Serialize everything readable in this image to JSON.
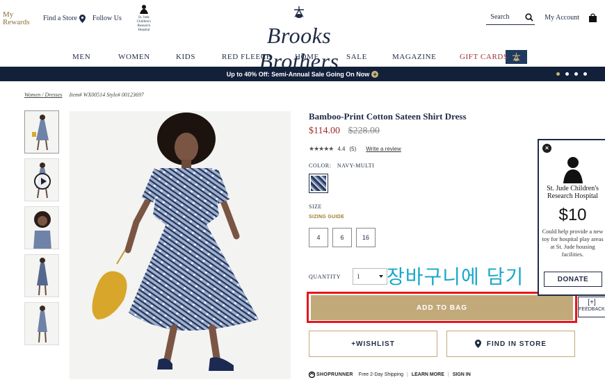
{
  "header": {
    "rewards_line1": "My",
    "rewards_line2": "Rewards",
    "find_store": "Find a Store",
    "follow_us": "Follow Us",
    "stjude_mini": "St. Jude Children's Research Hospital",
    "logo": "Brooks Brothers",
    "search_label": "Search",
    "my_account": "My Account"
  },
  "nav": {
    "items": [
      "MEN",
      "WOMEN",
      "KIDS",
      "RED FLEECE",
      "HOME",
      "SALE",
      "MAGAZINE",
      "GIFT CARDS"
    ]
  },
  "promo": {
    "text": "Up to 40% Off: Semi-Annual Sale Going On Now",
    "plus": "+"
  },
  "breadcrumb": {
    "path": "Women / Dresses",
    "item": "Item# WX00514 Style# 00123697"
  },
  "product": {
    "title": "Bamboo-Print Cotton Sateen Shirt Dress",
    "sale_price": "$114.00",
    "original_price": "$228.00",
    "stars": "★★★★★",
    "rating": "4.4",
    "review_count": "(5)",
    "write_review": "Write a review",
    "color_label": "COLOR:",
    "color_value": "NAVY-MULTI",
    "size_label": "SIZE",
    "sizing_guide": "SIZING GUIDE",
    "sizes": [
      "4",
      "6",
      "16"
    ],
    "quantity_label": "QUANTITY",
    "quantity_value": "1",
    "korean_caption": "장바구니에 담기",
    "add_to_bag": "ADD TO BAG",
    "wishlist": "+WISHLIST",
    "find_in_store": "FIND IN STORE"
  },
  "shoprunner": {
    "brand": "SHOPRUNNER",
    "shipping": "Free 2-Day Shipping",
    "learn_more": "LEARN MORE",
    "sign_in": "SIGN IN",
    "separator": "|"
  },
  "popup": {
    "close": "×",
    "org_line1": "St. Jude Children's",
    "org_line2": "Research Hospital",
    "amount": "$10",
    "description": "Could help provide a new toy for hospital play areas at St. Jude housing facilities.",
    "donate": "DONATE"
  },
  "feedback": {
    "plus": "[+]",
    "label": "FEEDBACK"
  },
  "colors": {
    "navy": "#1f2a44",
    "gold": "#c2a97a",
    "sale_red": "#a02a2a",
    "highlight_red": "#e3161b",
    "caption_blue": "#18a7cc"
  }
}
